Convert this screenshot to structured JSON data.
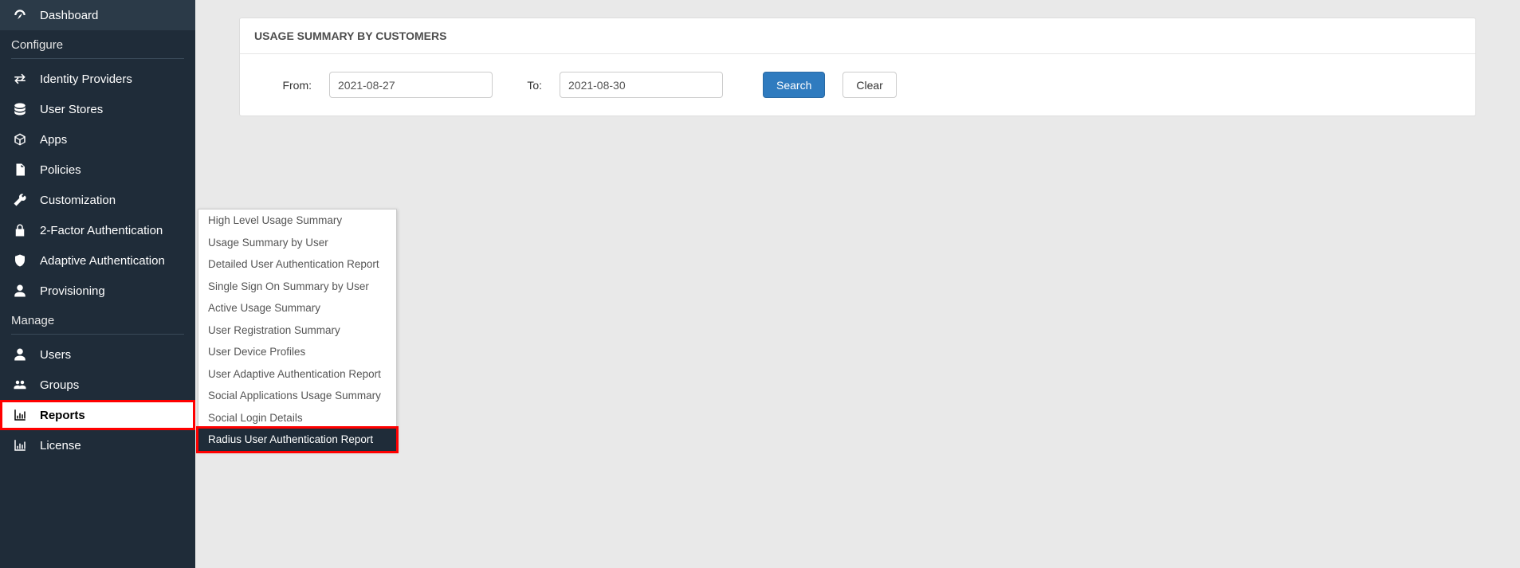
{
  "sidebar": {
    "top": {
      "dashboard": "Dashboard"
    },
    "sections": {
      "configure": "Configure",
      "manage": "Manage"
    },
    "configure_items": [
      "Identity Providers",
      "User Stores",
      "Apps",
      "Policies",
      "Customization",
      "2-Factor Authentication",
      "Adaptive Authentication",
      "Provisioning"
    ],
    "manage_items": [
      "Users",
      "Groups",
      "Reports",
      "License"
    ]
  },
  "submenu": {
    "items": [
      "High Level Usage Summary",
      "Usage Summary by User",
      "Detailed User Authentication Report",
      "Single Sign On Summary by User",
      "Active Usage Summary",
      "User Registration Summary",
      "User Device Profiles",
      "User Adaptive Authentication Report",
      "Social Applications Usage Summary",
      "Social Login Details",
      "Radius User Authentication Report"
    ],
    "selected_index": 10
  },
  "panel": {
    "title": "USAGE SUMMARY BY CUSTOMERS",
    "from_label": "From:",
    "to_label": "To:",
    "from_value": "2021-08-27",
    "to_value": "2021-08-30",
    "search_btn": "Search",
    "clear_btn": "Clear"
  }
}
